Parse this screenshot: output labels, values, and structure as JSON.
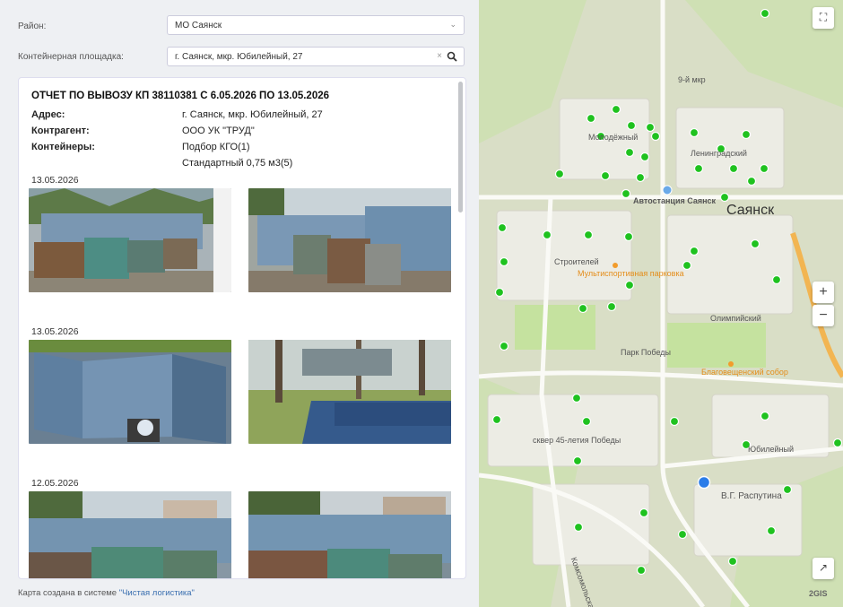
{
  "filters": {
    "district_label": "Район:",
    "district_value": "МО Саянск",
    "site_label": "Контейнерная площадка:",
    "site_value": "г. Саянск, мкр. Юбилейный, 27"
  },
  "report": {
    "title": "ОТЧЕТ ПО ВЫВОЗУ КП 38110381 С 6.05.2026 ПО 13.05.2026",
    "address_label": "Адрес:",
    "address_value": "г. Саянск, мкр. Юбилейный, 27",
    "contractor_label": "Контрагент:",
    "contractor_value": "ООО УК \"ТРУД\"",
    "containers_label": "Контейнеры:",
    "containers_value_1": "Подбор КГО(1)",
    "containers_value_2": "Стандартный 0,75 м3(5)",
    "groups": [
      {
        "date": "13.05.2026"
      },
      {
        "date": "13.05.2026"
      },
      {
        "date": "12.05.2026"
      }
    ]
  },
  "footer": {
    "prefix": "Карта создана в системе ",
    "link": "\"Чистая логистика\""
  },
  "map": {
    "city_label": "Саянск",
    "labels": {
      "l1": "9-й мкр",
      "l2": "Молодёжный",
      "l3": "Ленинградский",
      "l4": "Автостанция Саянск",
      "l5": "Строителей",
      "l6": "Мультиспортивная парковка",
      "l7": "Олимпийский",
      "l8": "Парк Победы",
      "l9": "Благовещенский собор",
      "l10": "сквер 45-летия Победы",
      "l11": "В.Г. Распутина",
      "l12": "Комсомольская",
      "l13": "Юбилейный"
    },
    "attribution": "2GIS",
    "zoom_in": "+",
    "zoom_out": "−",
    "accent_point": "#2b7de9",
    "container_point": "#1fc21f"
  }
}
